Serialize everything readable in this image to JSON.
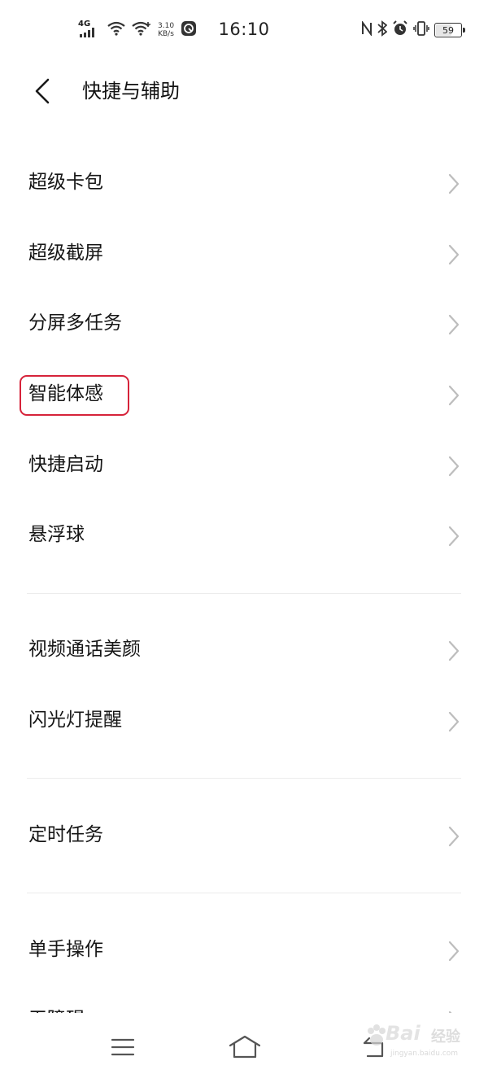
{
  "status_bar": {
    "network_type": "4G",
    "net_speed_value": "3.10",
    "net_speed_unit": "KB/s",
    "time": "16:10",
    "battery_level": "59",
    "icons": [
      "signal-icon",
      "wifi-icon",
      "wifi-icon",
      "data-saver-icon",
      "nfc-icon",
      "bluetooth-icon",
      "alarm-icon",
      "vibrate-icon",
      "battery-icon"
    ]
  },
  "header": {
    "title": "快捷与辅助"
  },
  "items": [
    {
      "label": "超级卡包"
    },
    {
      "label": "超级截屏"
    },
    {
      "label": "分屏多任务"
    },
    {
      "label": "智能体感",
      "highlighted": true
    },
    {
      "label": "快捷启动"
    },
    {
      "label": "悬浮球"
    },
    {
      "label": "视频通话美颜"
    },
    {
      "label": "闪光灯提醒"
    },
    {
      "label": "定时任务"
    },
    {
      "label": "单手操作"
    },
    {
      "label": "无障碍"
    }
  ],
  "watermark": {
    "word": "Bai",
    "suffix": "经验",
    "url": "jingyan.baidu.com"
  },
  "colors": {
    "highlight": "#d6233a",
    "chevron": "#bdbdbd",
    "divider": "#ececec",
    "text": "#161616"
  }
}
